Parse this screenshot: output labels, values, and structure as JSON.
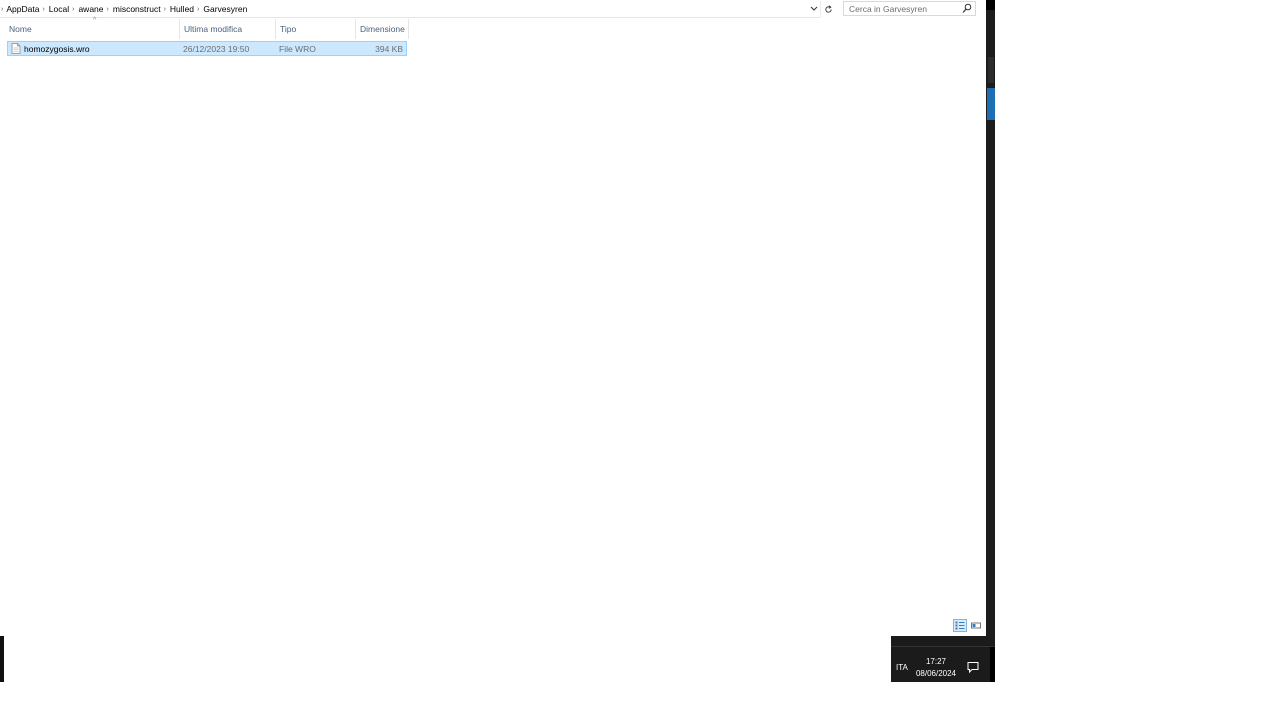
{
  "breadcrumb": [
    "AppData",
    "Local",
    "awane",
    "misconstruct",
    "Hulled",
    "Garvesyren"
  ],
  "search": {
    "placeholder": "Cerca in Garvesyren"
  },
  "columns": {
    "name": "Nome",
    "date": "Ultima modifica",
    "type": "Tipo",
    "size": "Dimensione"
  },
  "files": [
    {
      "name": "homozygosis.wro",
      "date": "26/12/2023 19:50",
      "type": "File WRO",
      "size": "394 KB",
      "selected": true
    }
  ],
  "taskbar": {
    "language": "ITA",
    "time": "17:27",
    "date": "08/06/2024"
  },
  "icons": {
    "addressbar": [
      "chevron-right-icon",
      "chevron-down-icon",
      "refresh-icon"
    ],
    "search": "search-icon",
    "file": "file-icon",
    "view": [
      "details-view-icon",
      "large-icons-view-icon"
    ],
    "tray": "notification-icon"
  },
  "colors": {
    "selection_bg": "#cce8ff",
    "selection_border": "#99d1ff",
    "header_text": "#4c607a",
    "taskbar": "#1b1b1b",
    "accent": "#1f6fb5"
  }
}
